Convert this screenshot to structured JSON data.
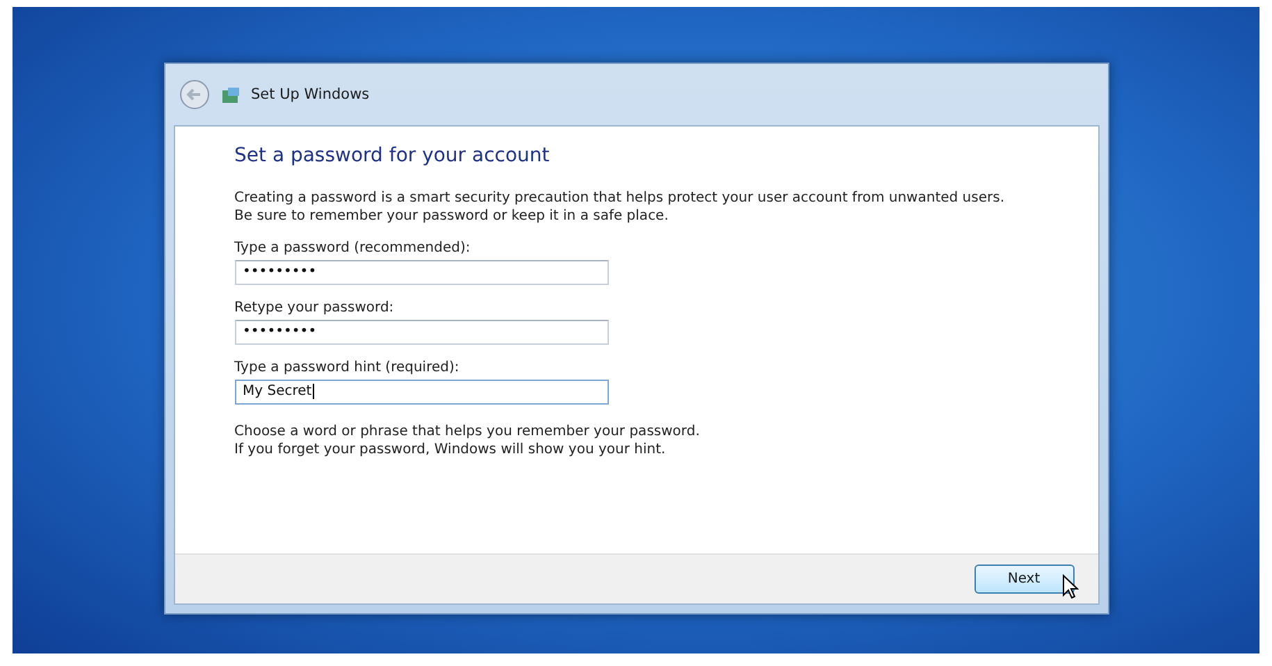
{
  "window": {
    "title": "Set Up Windows"
  },
  "heading": "Set a password for your account",
  "intro": "Creating a password is a smart security precaution that helps protect your user account from unwanted users. Be sure to remember your password or keep it in a safe place.",
  "fields": [
    {
      "label": "Type a password (recommended):",
      "value": "•••••••••",
      "focused": false
    },
    {
      "label": "Retype your password:",
      "value": "•••••••••",
      "focused": false
    },
    {
      "label": "Type a password hint (required):",
      "value": "My Secret",
      "focused": true
    }
  ],
  "note": [
    "Choose a word or phrase that helps you remember your password.",
    "If you forget your password, Windows will show you your hint."
  ],
  "buttons": [
    "Next"
  ]
}
